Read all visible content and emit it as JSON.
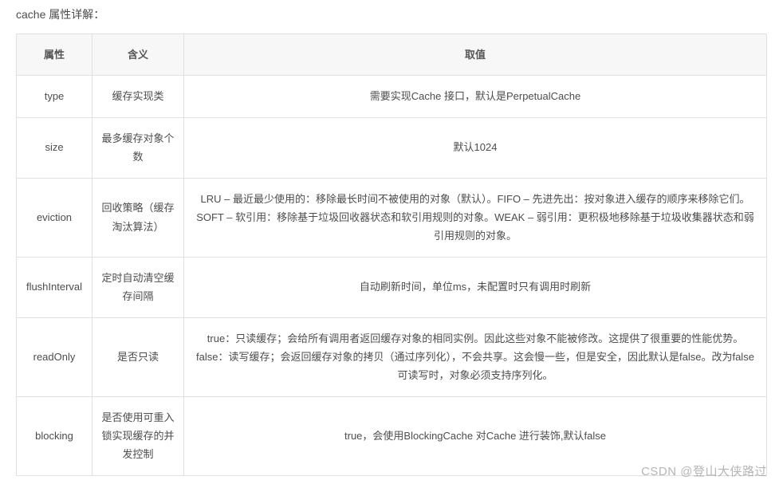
{
  "title": "cache 属性详解：",
  "headers": {
    "attr": "属性",
    "meaning": "含义",
    "value": "取值"
  },
  "rows": [
    {
      "attr": "type",
      "meaning": "缓存实现类",
      "value": "需要实现Cache 接口，默认是PerpetualCache"
    },
    {
      "attr": "size",
      "meaning": "最多缓存对象个数",
      "value": "默认1024"
    },
    {
      "attr": "eviction",
      "meaning": "回收策略（缓存淘汰算法）",
      "value": "LRU – 最近最少使用的：移除最长时间不被使用的对象（默认）。FIFO – 先进先出：按对象进入缓存的顺序来移除它们。SOFT – 软引用：移除基于垃圾回收器状态和软引用规则的对象。WEAK – 弱引用：更积极地移除基于垃圾收集器状态和弱引用规则的对象。"
    },
    {
      "attr": "flushInterval",
      "meaning": "定时自动清空缓存间隔",
      "value": "自动刷新时间，单位ms，未配置时只有调用时刷新"
    },
    {
      "attr": "readOnly",
      "meaning": "是否只读",
      "value": "true：只读缓存；会给所有调用者返回缓存对象的相同实例。因此这些对象不能被修改。这提供了很重要的性能优势。false：读写缓存；会返回缓存对象的拷贝（通过序列化），不会共享。这会慢一些，但是安全，因此默认是false。改为false 可读写时，对象必须支持序列化。"
    },
    {
      "attr": "blocking",
      "meaning": "是否使用可重入锁实现缓存的并发控制",
      "value": "true，会使用BlockingCache 对Cache 进行装饰,默认false"
    }
  ],
  "watermark": "CSDN @登山大侠路过"
}
